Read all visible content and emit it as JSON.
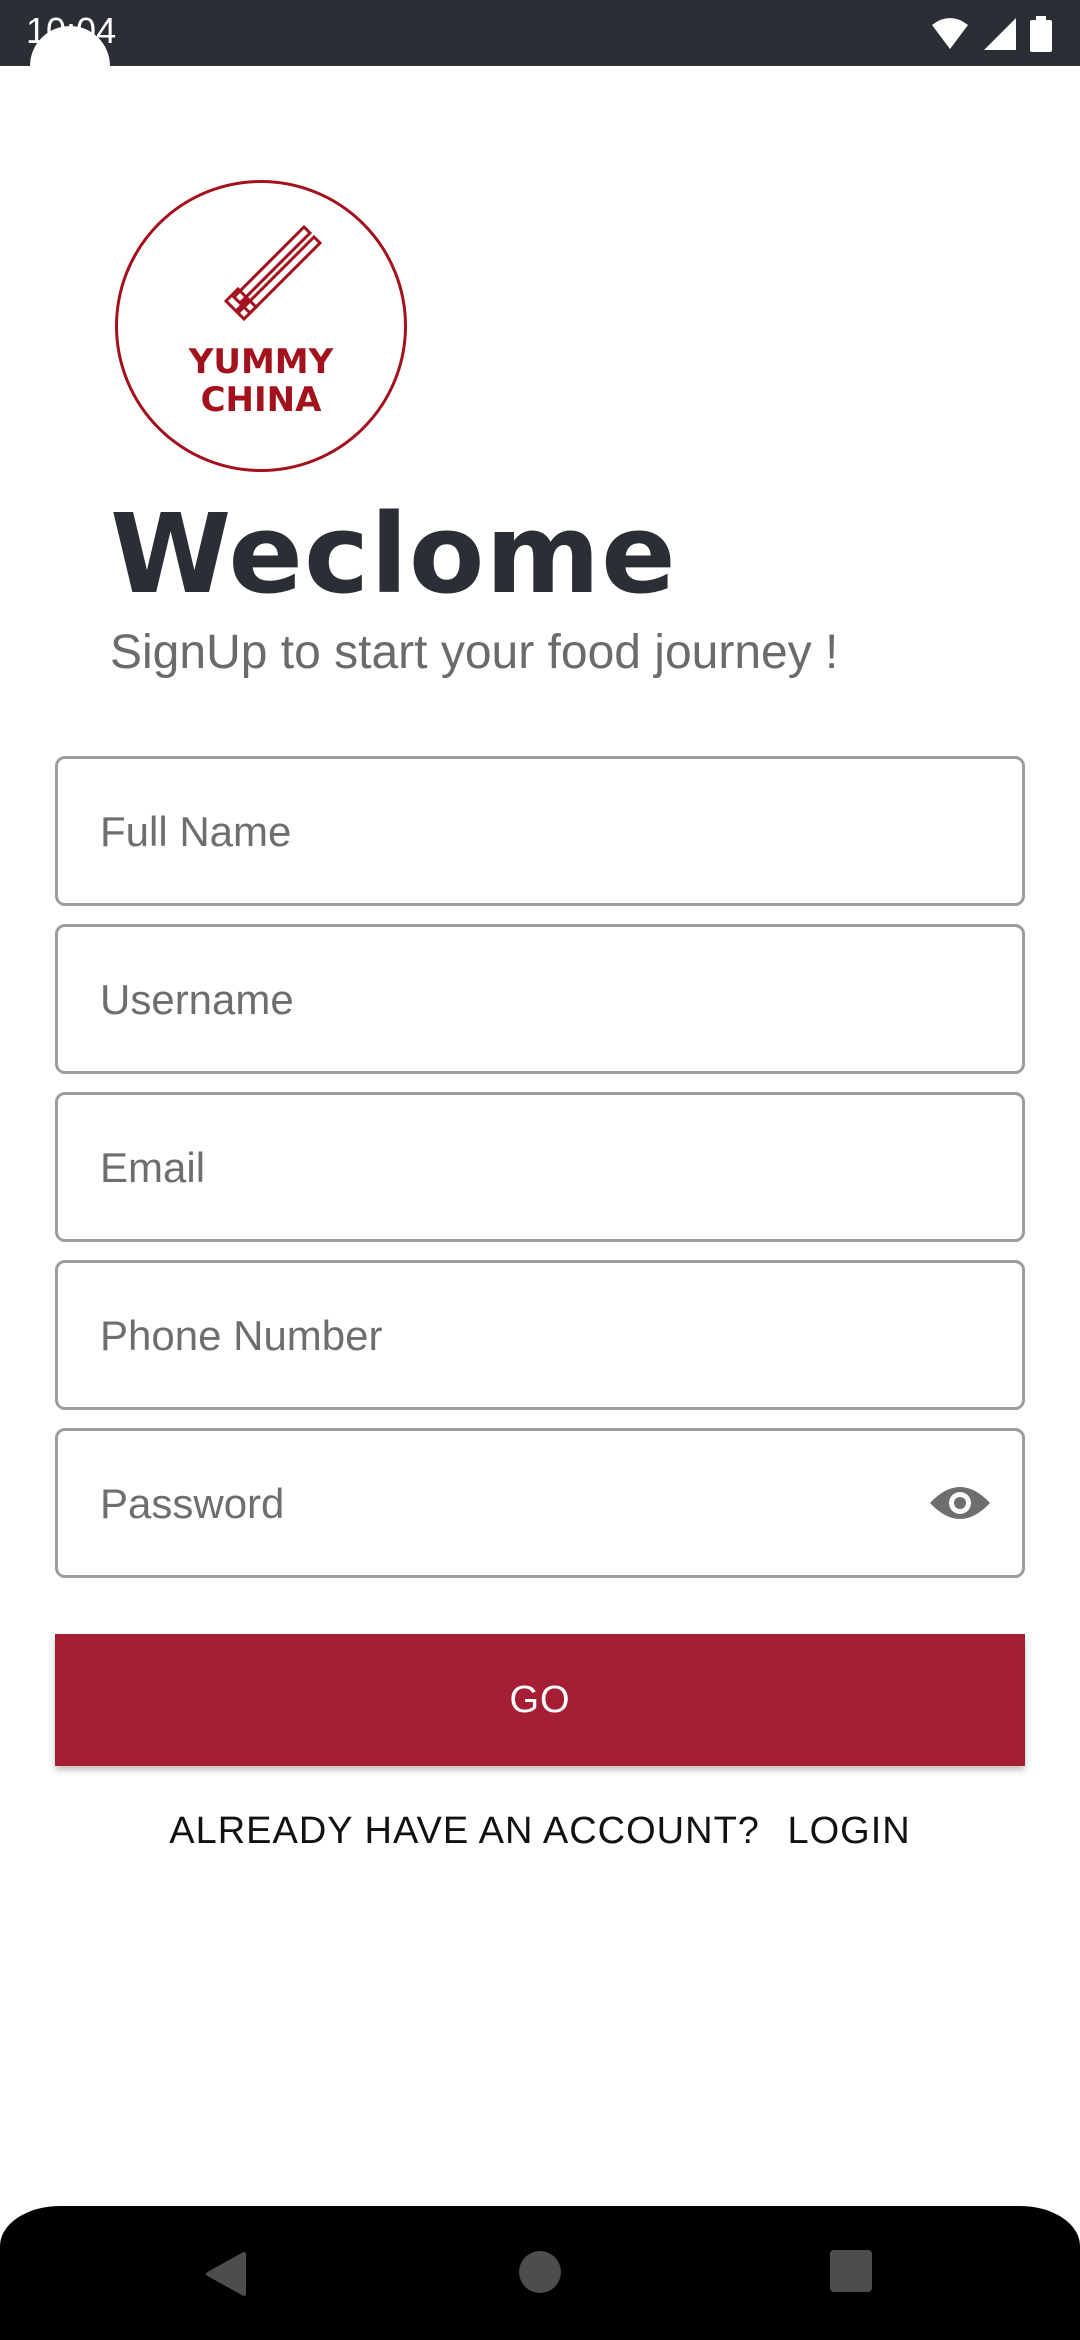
{
  "status_bar": {
    "time": "10:04",
    "icons": [
      "wifi-icon",
      "signal-icon",
      "battery-icon"
    ]
  },
  "logo": {
    "line1": "YUMMY",
    "line2": "CHINA",
    "color": "#a3121c"
  },
  "header": {
    "title": "Weclome",
    "subtitle": "SignUp to start your food journey !"
  },
  "form": {
    "full_name_placeholder": "Full Name",
    "username_placeholder": "Username",
    "email_placeholder": "Email",
    "phone_placeholder": "Phone Number",
    "password_placeholder": "Password"
  },
  "actions": {
    "go_label": "GO",
    "already_label": "ALREADY HAVE AN ACCOUNT?",
    "login_label": "LOGIN",
    "button_color": "#a51e33"
  },
  "nav": {
    "icons": [
      "back-icon",
      "home-icon",
      "recents-icon"
    ]
  }
}
